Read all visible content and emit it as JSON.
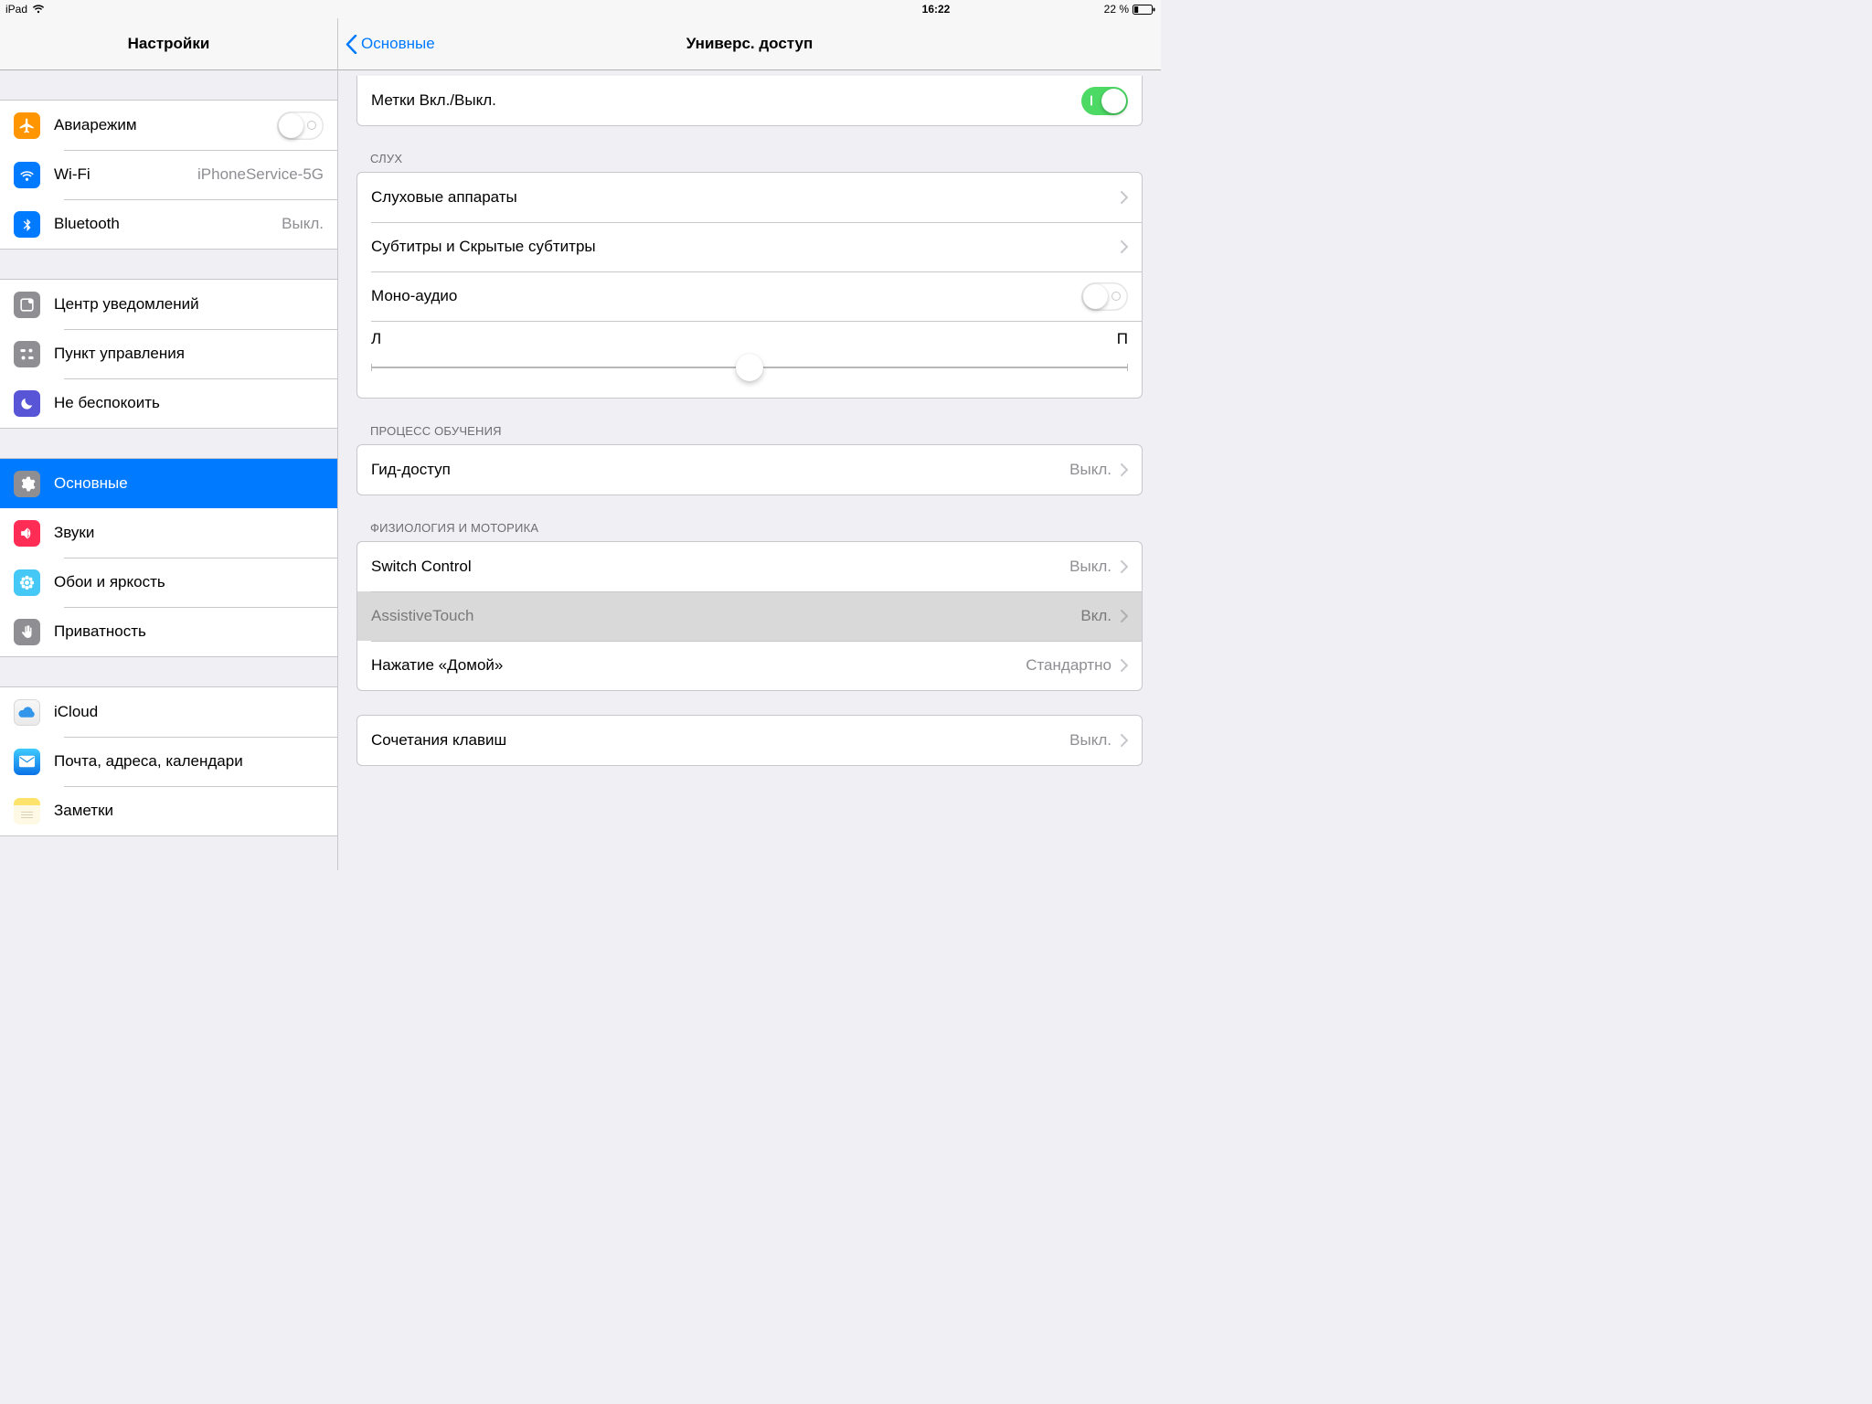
{
  "status": {
    "device": "iPad",
    "time": "16:22",
    "battery_text": "22 %"
  },
  "sidebar": {
    "title": "Настройки",
    "groups": [
      [
        {
          "label": "Авиарежим",
          "value": "",
          "toggle": false
        },
        {
          "label": "Wi-Fi",
          "value": "iPhoneService-5G"
        },
        {
          "label": "Bluetooth",
          "value": "Выкл."
        }
      ],
      [
        {
          "label": "Центр уведомлений"
        },
        {
          "label": "Пункт управления"
        },
        {
          "label": "Не беспокоить"
        }
      ],
      [
        {
          "label": "Основные",
          "selected": true
        },
        {
          "label": "Звуки"
        },
        {
          "label": "Обои и яркость"
        },
        {
          "label": "Приватность"
        }
      ],
      [
        {
          "label": "iCloud"
        },
        {
          "label": "Почта, адреса, календари"
        },
        {
          "label": "Заметки"
        }
      ]
    ]
  },
  "detail": {
    "back": "Основные",
    "title": "Универс. доступ",
    "labels_toggle": {
      "label": "Метки Вкл./Выкл.",
      "on": true
    },
    "sections": {
      "hearing": {
        "title": "СЛУХ",
        "rows": {
          "aids": "Слуховые аппараты",
          "subtitles": "Субтитры и Скрытые субтитры",
          "mono": "Моно-аудио"
        },
        "balance": {
          "left": "Л",
          "right": "П",
          "value": 0.5
        }
      },
      "learning": {
        "title": "ПРОЦЕСС ОБУЧЕНИЯ",
        "guided": {
          "label": "Гид-доступ",
          "value": "Выкл."
        }
      },
      "motor": {
        "title": "ФИЗИОЛОГИЯ И МОТОРИКА",
        "switch": {
          "label": "Switch Control",
          "value": "Выкл."
        },
        "assistive": {
          "label": "AssistiveTouch",
          "value": "Вкл."
        },
        "home": {
          "label": "Нажатие «Домой»",
          "value": "Стандартно"
        }
      },
      "shortcut": {
        "label": "Сочетания клавиш",
        "value": "Выкл."
      }
    }
  },
  "icons": {
    "airplane": {
      "bg": "#ff9500",
      "glyph": "airplane"
    },
    "wifi": {
      "bg": "#007aff",
      "glyph": "wifi"
    },
    "bluetooth": {
      "bg": "#007aff",
      "glyph": "bluetooth"
    },
    "notif": {
      "bg": "#8e8e93",
      "glyph": "notif"
    },
    "control": {
      "bg": "#8e8e93",
      "glyph": "control"
    },
    "dnd": {
      "bg": "#5856d6",
      "glyph": "moon"
    },
    "general": {
      "bg": "#8e8e93",
      "glyph": "gear"
    },
    "sounds": {
      "bg": "#ff2d55",
      "glyph": "speaker"
    },
    "wallpaper": {
      "bg": "#45c8f6",
      "glyph": "flower"
    },
    "privacy": {
      "bg": "#8e8e93",
      "glyph": "hand"
    },
    "icloud": {
      "bg": "#ffffff",
      "glyph": "cloud"
    },
    "mail": {
      "bg": "#ffffff",
      "glyph": "mail"
    },
    "notes": {
      "bg": "#ffffff",
      "glyph": "notes"
    }
  }
}
